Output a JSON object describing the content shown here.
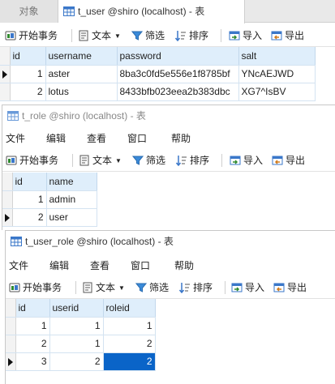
{
  "window1": {
    "tab_inactive": "对象",
    "tab_active": "t_user @shiro (localhost) - 表",
    "toolbar": {
      "begin_tx": "开始事务",
      "text": "文本",
      "filter": "筛选",
      "sort": "排序",
      "import": "导入",
      "export": "导出"
    },
    "columns": [
      "id",
      "username",
      "password",
      "salt"
    ],
    "rows": [
      {
        "id": "1",
        "username": "aster",
        "password": "8ba3c0fd5e556e1f8785bf",
        "salt": "YNcAEJWD",
        "current": true
      },
      {
        "id": "2",
        "username": "lotus",
        "password": "8433bfb023eea2b383dbc",
        "salt": "XG7^IsBV",
        "current": false
      }
    ]
  },
  "window2": {
    "title": "t_role @shiro (localhost) - 表",
    "menu": [
      "文件",
      "编辑",
      "查看",
      "窗口",
      "帮助"
    ],
    "toolbar": {
      "begin_tx": "开始事务",
      "text": "文本",
      "filter": "筛选",
      "sort": "排序",
      "import": "导入",
      "export": "导出"
    },
    "columns": [
      "id",
      "name"
    ],
    "rows": [
      {
        "id": "1",
        "name": "admin",
        "current": false
      },
      {
        "id": "2",
        "name": "user",
        "current": true
      }
    ]
  },
  "window3": {
    "title": "t_user_role @shiro (localhost) - 表",
    "menu": [
      "文件",
      "编辑",
      "查看",
      "窗口",
      "帮助"
    ],
    "toolbar": {
      "begin_tx": "开始事务",
      "text": "文本",
      "filter": "筛选",
      "sort": "排序",
      "import": "导入",
      "export": "导出"
    },
    "columns": [
      "id",
      "userid",
      "roleid"
    ],
    "rows": [
      {
        "id": "1",
        "userid": "1",
        "roleid": "1",
        "current": false
      },
      {
        "id": "2",
        "userid": "1",
        "roleid": "2",
        "current": false
      },
      {
        "id": "3",
        "userid": "2",
        "roleid": "2",
        "current": true
      }
    ]
  },
  "colors": {
    "header_bg": "#dfeefb",
    "selection": "#0a64c8",
    "grid_line": "#d4e3f1"
  },
  "icons": [
    "table-icon",
    "transaction-icon",
    "text-icon",
    "filter-icon",
    "sort-icon",
    "import-icon",
    "export-icon",
    "row-pointer-icon"
  ]
}
